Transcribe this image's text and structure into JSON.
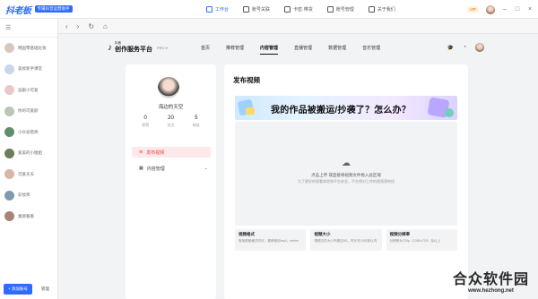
{
  "app": {
    "logo": "抖老板",
    "logo_badge": "专属抖音运营助手",
    "nav": [
      {
        "label": "工作台",
        "active": true
      },
      {
        "label": "账号关联",
        "active": false
      },
      {
        "label": "卡密·带货",
        "active": false
      },
      {
        "label": "账号管理",
        "active": false
      },
      {
        "label": "关于我们",
        "active": false
      }
    ],
    "vip": "VIP",
    "window": {
      "minimize": "–",
      "maximize": "□",
      "close": "×"
    }
  },
  "accounts": {
    "header_icon": "☰",
    "items": [
      {
        "name": "韩国零基础化妆",
        "color": "#d8c7c0"
      },
      {
        "name": "美妆新手课堂",
        "color": "#c8d6e8"
      },
      {
        "name": "追剧小可爱",
        "color": "#e7c9c9"
      },
      {
        "name": "你的可爱颜",
        "color": "#b9c8b5"
      },
      {
        "name": "小众穿搭师",
        "color": "#5f8f6a"
      },
      {
        "name": "爱美的小姐姐",
        "color": "#6a7d5c"
      },
      {
        "name": "可爱天天",
        "color": "#d9b6a6"
      },
      {
        "name": "彩妆师",
        "color": "#7f9bb0"
      },
      {
        "name": "素颜看看",
        "color": "#a98276"
      }
    ],
    "add_button": "+ 添加账号",
    "manage_button": "管理"
  },
  "browser": {
    "back": "‹",
    "forward": "›",
    "refresh": "↻",
    "home": "⌂"
  },
  "douyin": {
    "logo_small": "抖音",
    "logo_text": "创作服务平台",
    "logo_sub": "PRO ▾",
    "nav": [
      {
        "label": "首页",
        "active": false
      },
      {
        "label": "推荐管理",
        "active": false
      },
      {
        "label": "内容管理",
        "active": true
      },
      {
        "label": "直播管理",
        "active": false
      },
      {
        "label": "数据管理",
        "active": false
      },
      {
        "label": "音乐管理",
        "active": false
      }
    ]
  },
  "profile": {
    "name": "海边的天空",
    "stats": [
      {
        "value": "0",
        "label": "获赞"
      },
      {
        "value": "20",
        "label": "关注"
      },
      {
        "value": "5",
        "label": "粉丝"
      }
    ],
    "menu_publish": "发布视频",
    "menu_content": "内容管理"
  },
  "publish": {
    "title": "发布视频",
    "banner_text": "我的作品被搬运/抄袭了？怎么办？",
    "upload_main": "点击上传 或直接将视频文件拖入此区域",
    "upload_sub": "为了更好的观看体验和平台安全，平台将对上传的视频预审核",
    "tips": [
      {
        "title": "视频格式",
        "desc": "常用视频格式均可，推荐使用mp4、webm"
      },
      {
        "title": "视频大小",
        "desc": "视频文件大小不超过8G，时长在15分钟以内"
      },
      {
        "title": "视频分辨率",
        "desc": "分辨率为720p（1280×720）及以上"
      }
    ]
  },
  "watermark": {
    "main": "合众软件园",
    "url": "www.hezhong.net"
  }
}
